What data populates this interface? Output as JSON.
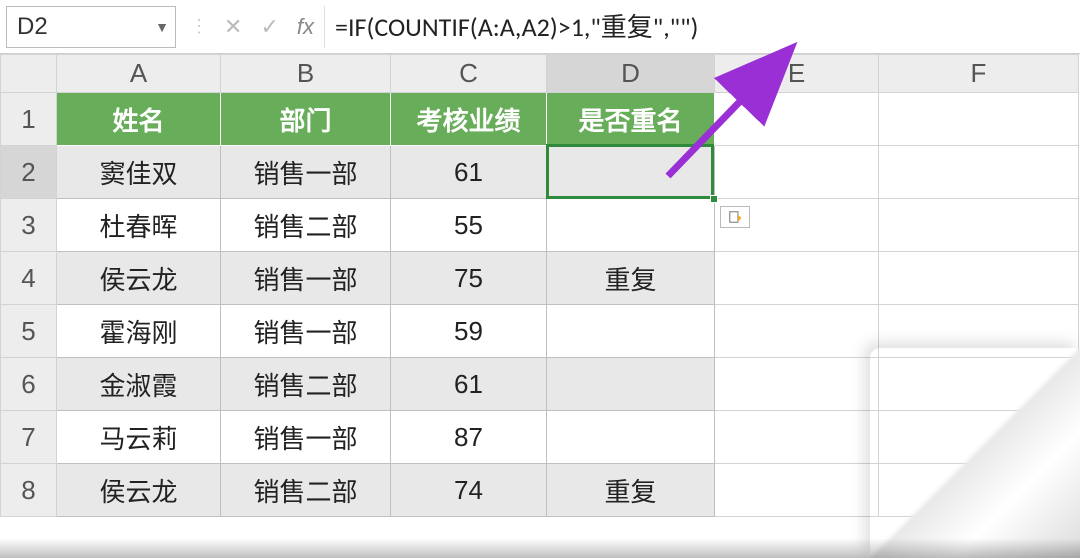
{
  "formula_bar": {
    "cell_ref": "D2",
    "fx_label": "fx",
    "formula": "=IF(COUNTIF(A:A,A2)>1,\"重复\",\"\")",
    "cancel_glyph": "✕",
    "accept_glyph": "✓"
  },
  "columns": [
    "A",
    "B",
    "C",
    "D",
    "E",
    "F"
  ],
  "row_numbers": [
    "1",
    "2",
    "3",
    "4",
    "5",
    "6",
    "7",
    "8"
  ],
  "headers": {
    "A": "姓名",
    "B": "部门",
    "C": "考核业绩",
    "D": "是否重名"
  },
  "rows": [
    {
      "A": "窦佳双",
      "B": "销售一部",
      "C": "61",
      "D": ""
    },
    {
      "A": "杜春晖",
      "B": "销售二部",
      "C": "55",
      "D": ""
    },
    {
      "A": "侯云龙",
      "B": "销售一部",
      "C": "75",
      "D": "重复"
    },
    {
      "A": "霍海刚",
      "B": "销售一部",
      "C": "59",
      "D": ""
    },
    {
      "A": "金淑霞",
      "B": "销售二部",
      "C": "61",
      "D": ""
    },
    {
      "A": "马云莉",
      "B": "销售一部",
      "C": "87",
      "D": ""
    },
    {
      "A": "侯云龙",
      "B": "销售二部",
      "C": "74",
      "D": "重复"
    }
  ],
  "selection": {
    "active_cell": "D2"
  },
  "colors": {
    "header_green": "#68ad59",
    "selection_border": "#2f8a3c",
    "arrow": "#9b2fd6"
  },
  "chart_data": {
    "type": "table",
    "title": "",
    "columns": [
      "姓名",
      "部门",
      "考核业绩",
      "是否重名"
    ],
    "records": [
      [
        "窦佳双",
        "销售一部",
        61,
        ""
      ],
      [
        "杜春晖",
        "销售二部",
        55,
        ""
      ],
      [
        "侯云龙",
        "销售一部",
        75,
        "重复"
      ],
      [
        "霍海刚",
        "销售一部",
        59,
        ""
      ],
      [
        "金淑霞",
        "销售二部",
        61,
        ""
      ],
      [
        "马云莉",
        "销售一部",
        87,
        ""
      ],
      [
        "侯云龙",
        "销售二部",
        74,
        "重复"
      ]
    ]
  }
}
